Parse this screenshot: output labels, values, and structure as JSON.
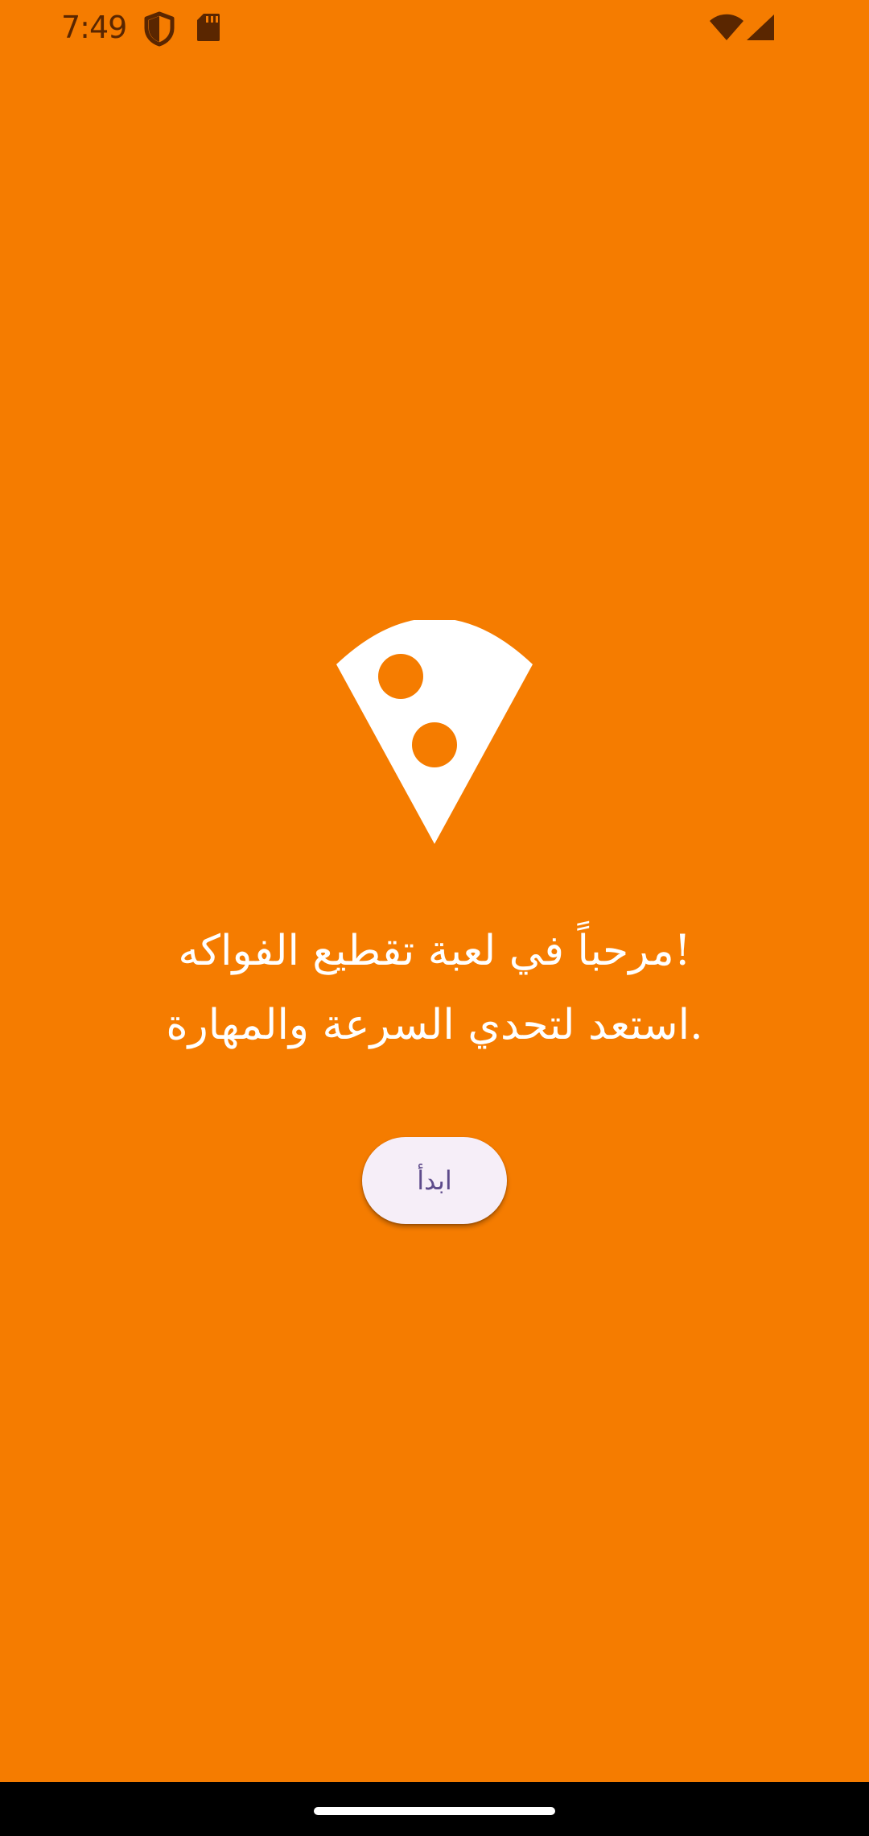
{
  "status_bar": {
    "time": "7:49",
    "icons": [
      "shield-icon",
      "sdcard-icon",
      "wifi-icon",
      "signal-icon"
    ],
    "icon_color": "#5A2600"
  },
  "main": {
    "logo": "pizza-slice-icon",
    "welcome_line1": "!مرحباً في لعبة تقطيع الفواكه",
    "welcome_line2": ".استعد لتحدي السرعة والمهارة",
    "start_button_label": "ابدأ"
  },
  "colors": {
    "background": "#F57C00",
    "text": "#FFFFFF",
    "button_bg": "#F6EEF8",
    "button_text": "#5E4B8B",
    "nav_bar": "#000000"
  }
}
